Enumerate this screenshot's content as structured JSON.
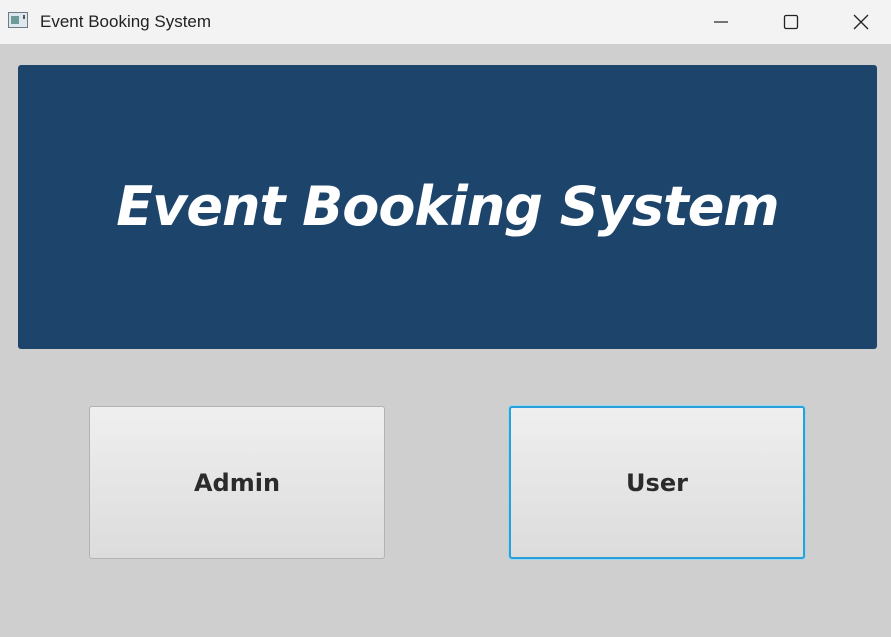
{
  "window": {
    "title": "Event Booking System",
    "controls": {
      "minimize": "minimize-icon",
      "maximize": "maximize-icon",
      "close": "close-icon"
    }
  },
  "banner": {
    "title": "Event Booking System",
    "background_color": "#1d456b",
    "text_color": "#ffffff"
  },
  "buttons": {
    "admin_label": "Admin",
    "user_label": "User",
    "focus_color": "#2aa0d8"
  }
}
